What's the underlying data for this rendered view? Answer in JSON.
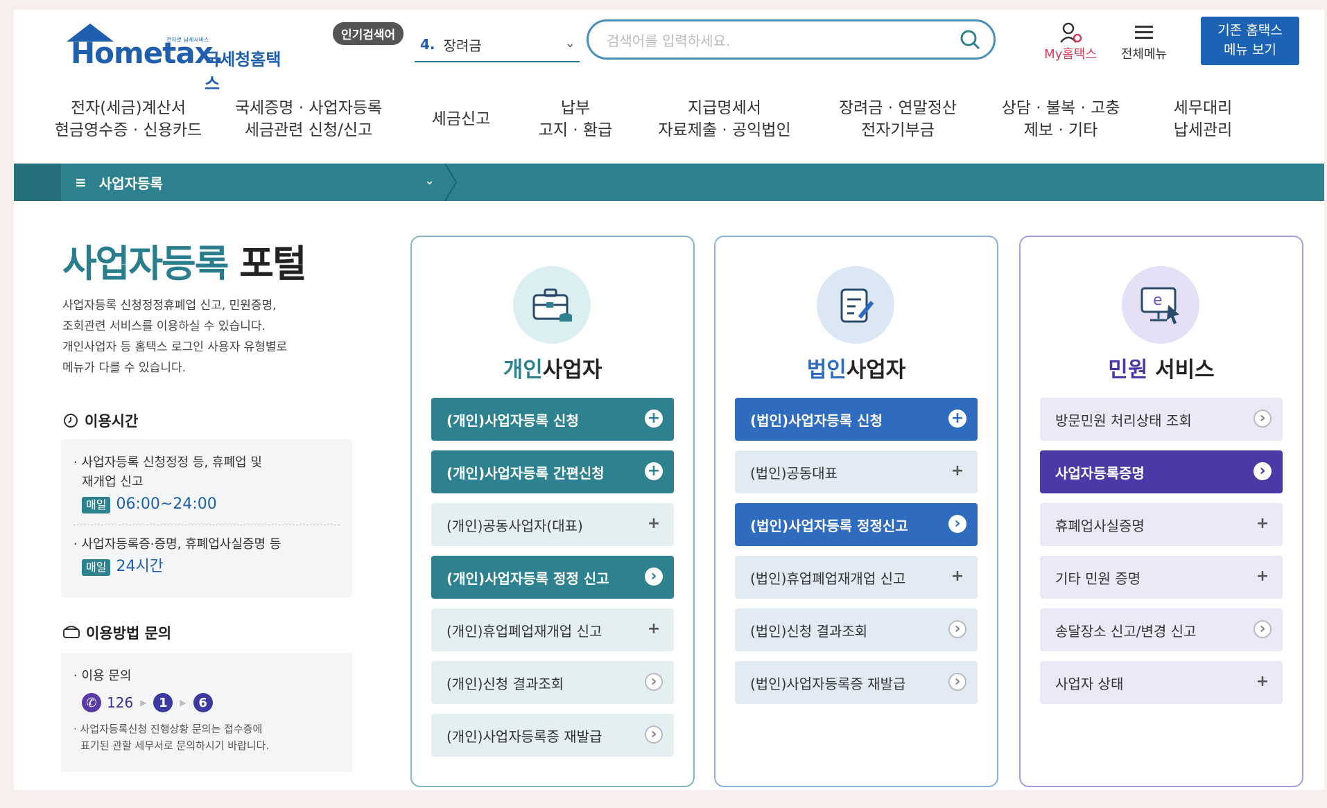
{
  "header": {
    "logo_small": "전자로 납세서비스",
    "logo_text": "Hometax.",
    "logo_ko": "국세청홈택스",
    "popular_label": "인기검색어",
    "popular_rank": "4.",
    "popular_keyword": "장려금",
    "search_placeholder": "검색어를 입력하세요.",
    "my_label": "My홈택스",
    "allmenu_label": "전체메뉴",
    "old_menu_line1": "기존 홈택스",
    "old_menu_line2": "메뉴 보기"
  },
  "nav": [
    {
      "line1": "전자(세금)계산서",
      "line2": "현금영수증 · 신용카드"
    },
    {
      "line1": "국세증명 · 사업자등록",
      "line2": "세금관련 신청/신고"
    },
    {
      "line1": "세금신고",
      "line2": ""
    },
    {
      "line1": "납부",
      "line2": "고지 · 환급"
    },
    {
      "line1": "지급명세서",
      "line2": "자료제출 · 공익법인"
    },
    {
      "line1": "장려금 · 연말정산",
      "line2": "전자기부금"
    },
    {
      "line1": "상담 · 불복 · 고충",
      "line2": "제보 · 기타"
    },
    {
      "line1": "세무대리",
      "line2": "납세관리"
    }
  ],
  "breadcrumb": {
    "label": "사업자등록"
  },
  "portal": {
    "title_part1": "사업자등록",
    "title_part2": "포털",
    "desc_lines": [
      "사업자등록 신청정정휴폐업 신고, 민원증명,",
      "조회관련 서비스를 이용하실 수 있습니다.",
      "개인사업자 등 홈택스 로그인 사용자 유형별로",
      "메뉴가 다를 수 있습니다."
    ],
    "hours_title": "이용시간",
    "hours": [
      {
        "text1": "· 사업자등록 신청정정 등, 휴폐업 및",
        "text2": "재개업 신고",
        "badge": "매일",
        "time": "06:00~24:00"
      },
      {
        "text1": "· 사업자등록증·증명, 휴폐업사실증명 등",
        "text2": "",
        "badge": "매일",
        "time": "24시간"
      }
    ],
    "inquiry_title": "이용방법 문의",
    "inquiry_label": "· 이용 문의",
    "inquiry_number": "126",
    "inquiry_step1": "1",
    "inquiry_step2": "6",
    "inquiry_note1": "· 사업자등록신청 진행상황 문의는 접수증에",
    "inquiry_note2": "표기된 관할 세무서로 문의하시기 바랍니다."
  },
  "cards": [
    {
      "title_accent": "개인",
      "title_rest": "사업자",
      "icon": "briefcase-icon",
      "accent": "#2e8290",
      "items": [
        {
          "label": "(개인)사업자등록 신청",
          "style": "solid",
          "icon": "plus"
        },
        {
          "label": "(개인)사업자등록 간편신청",
          "style": "solid",
          "icon": "plus"
        },
        {
          "label": "(개인)공동사업자(대표)",
          "style": "light",
          "icon": "plus"
        },
        {
          "label": "(개인)사업자등록 정정 신고",
          "style": "solid",
          "icon": "arrow"
        },
        {
          "label": "(개인)휴업폐업재개업 신고",
          "style": "light",
          "icon": "plus"
        },
        {
          "label": "(개인)신청 결과조회",
          "style": "light",
          "icon": "arrow"
        },
        {
          "label": "(개인)사업자등록증 재발급",
          "style": "light",
          "icon": "arrow"
        }
      ]
    },
    {
      "title_accent": "법인",
      "title_rest": "사업자",
      "icon": "document-pen-icon",
      "accent": "#2f6cc0",
      "items": [
        {
          "label": "(법인)사업자등록 신청",
          "style": "solid",
          "icon": "plus"
        },
        {
          "label": "(법인)공동대표",
          "style": "light",
          "icon": "plus"
        },
        {
          "label": "(법인)사업자등록 정정신고",
          "style": "solid",
          "icon": "arrow"
        },
        {
          "label": "(법인)휴업폐업재개업 신고",
          "style": "light",
          "icon": "plus"
        },
        {
          "label": "(법인)신청 결과조회",
          "style": "light",
          "icon": "arrow"
        },
        {
          "label": "(법인)사업자등록증 재발급",
          "style": "light",
          "icon": "arrow"
        }
      ]
    },
    {
      "title_accent": "민원",
      "title_rest": " 서비스",
      "icon": "e-monitor-icon",
      "accent": "#4a3aa8",
      "items": [
        {
          "label": "방문민원 처리상태 조회",
          "style": "light",
          "icon": "arrow"
        },
        {
          "label": "사업자등록증명",
          "style": "solid",
          "icon": "arrow"
        },
        {
          "label": "휴폐업사실증명",
          "style": "light",
          "icon": "plus"
        },
        {
          "label": "기타 민원 증명",
          "style": "light",
          "icon": "plus"
        },
        {
          "label": "송달장소 신고/변경 신고",
          "style": "light",
          "icon": "arrow"
        },
        {
          "label": "사업자 상태",
          "style": "light",
          "icon": "plus"
        }
      ]
    }
  ]
}
